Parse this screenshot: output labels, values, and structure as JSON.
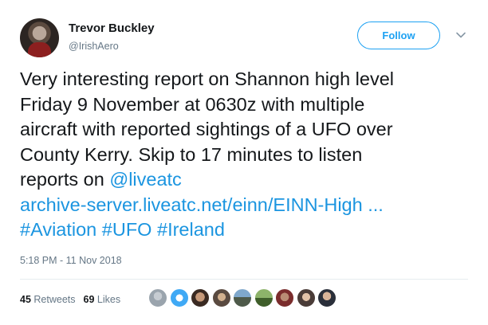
{
  "author": {
    "name": "Trevor Buckley",
    "handle": "@IrishAero"
  },
  "follow_button_label": "Follow",
  "tweet": {
    "line1": "Very interesting report on Shannon high level",
    "line2": "Friday 9 November at 0630z with multiple",
    "line3": "aircraft with reported sightings of a UFO over",
    "line4": "County Kerry. Skip to 17 minutes to listen",
    "line5_prefix": "reports on ",
    "mention": "@liveatc",
    "url": "archive-server.liveatc.net/einn/EINN-High ...",
    "hashtag1": "#Aviation",
    "hashtag2": "#UFO",
    "hashtag3": "#Ireland"
  },
  "timestamp": "5:18 PM - 11 Nov 2018",
  "stats": {
    "retweets_count": "45",
    "retweets_label": "Retweets",
    "likes_count": "69",
    "likes_label": "Likes"
  },
  "icons": {
    "chevron": "chevron-down-icon"
  },
  "colors": {
    "link": "#1b95e0",
    "follow_accent": "#1da1f2",
    "secondary_text": "#657786"
  }
}
